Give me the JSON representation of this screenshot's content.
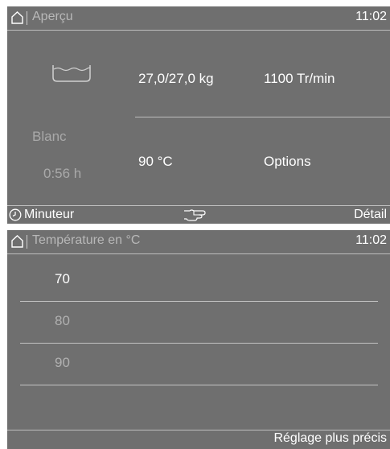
{
  "overview": {
    "title": "Aperçu",
    "time": "11:02",
    "icon": "basin-icon",
    "load": "27,0/27,0 kg",
    "spin": "1100 Tr/min",
    "program": "Blanc",
    "duration": "0:56 h",
    "temperature": "90 °C",
    "options": "Options",
    "bottom": {
      "left_label": "Minuteur",
      "right_label": "Détail"
    }
  },
  "temperature_menu": {
    "title": "Température en °C",
    "time": "11:02",
    "items": [
      {
        "label": "70",
        "selected": true
      },
      {
        "label": "80",
        "selected": false
      },
      {
        "label": "90",
        "selected": false
      }
    ],
    "bottom_right": "Réglage plus précis"
  },
  "colors": {
    "screen": "#6f6f6f",
    "text": "#ffffff",
    "dim_text": "#a9a9a9",
    "rule": "#bdbdbd"
  }
}
